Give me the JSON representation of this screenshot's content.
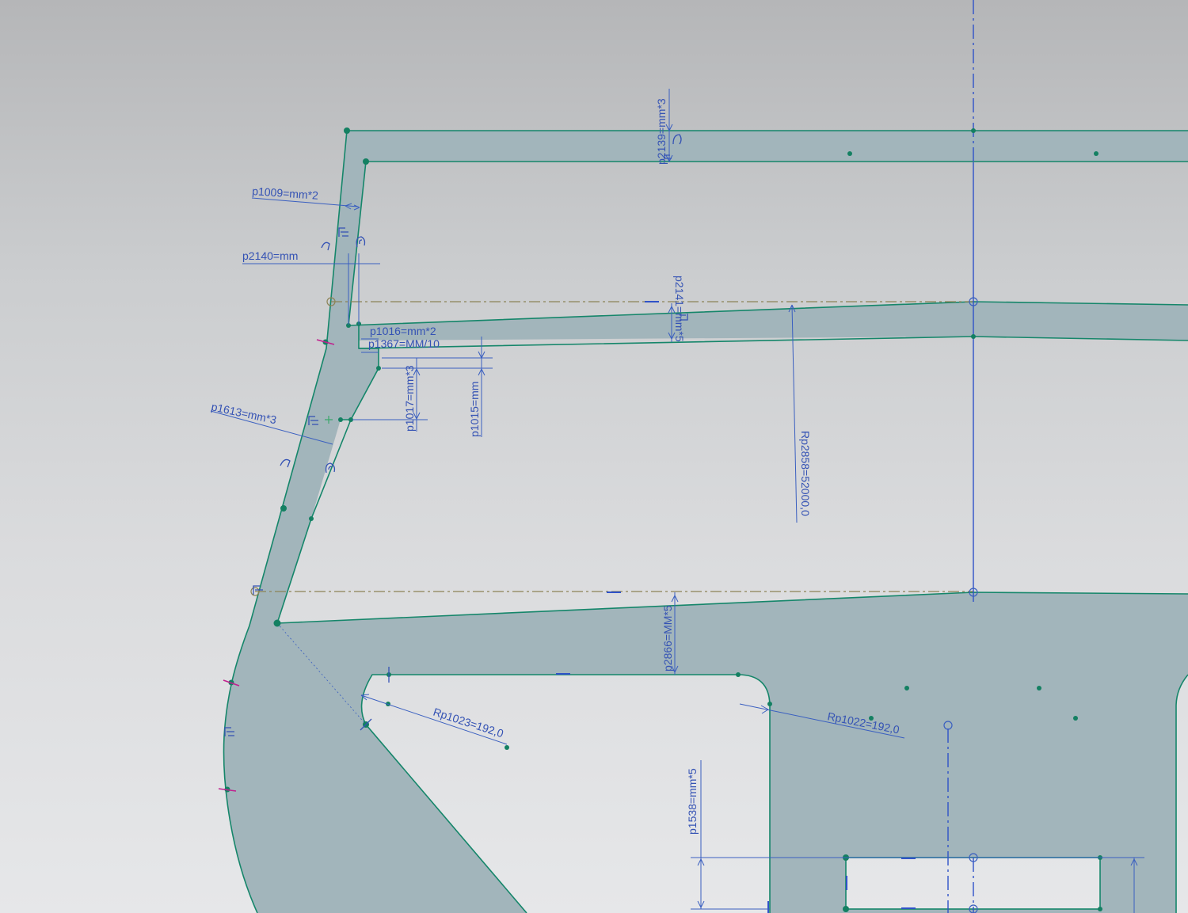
{
  "sketch": {
    "dimensions": {
      "p1009": "p1009=mm*2",
      "p2140": "p2140=mm",
      "p2139": "p2139=mm*3",
      "p1016": "p1016=mm*2",
      "p1367": "p1367=MM/10",
      "p1017": "p1017=mm*3",
      "p1015": "p1015=mm",
      "p1613": "p1613=mm*3",
      "p2141": "p2141=mm*5",
      "rp2858": "Rp2858=52000,0",
      "p2866": "p2866=MM*5",
      "rp1023": "Rp1023=192,0",
      "rp1022": "Rp1022=192,0",
      "p1538": "p1538=mm*5"
    },
    "colors": {
      "background_top": "#b5b6b8",
      "background_bottom": "#e6e7e9",
      "solid_fill": "#a2b5bb",
      "edge": "#15866a",
      "dimension": "#3452b4",
      "reference_line": "#8c8356",
      "constraint_marker": "#c0208e"
    },
    "icons": {
      "tangent": "tangent-constraint-icon",
      "coincident": "coincident-constraint-icon",
      "parallel": "parallel-constraint-icon",
      "horizontal": "horizontal-constraint-icon"
    }
  }
}
